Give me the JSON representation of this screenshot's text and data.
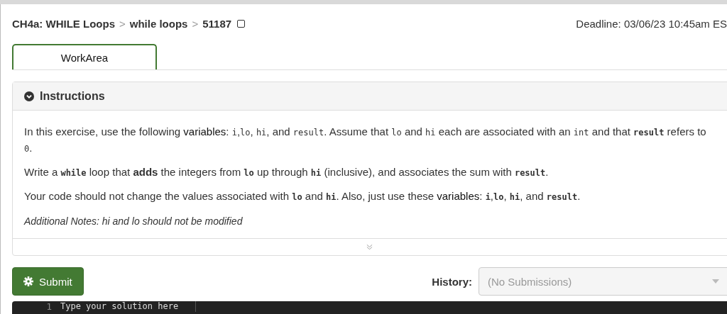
{
  "breadcrumb": [
    {
      "label": "CH4a: WHILE Loops"
    },
    {
      "label": "while loops"
    },
    {
      "label": "51187"
    }
  ],
  "breadcrumb_separator": ">",
  "bookmark": {
    "checked": false
  },
  "deadline": "Deadline: 03/06/23 10:45am ES",
  "tabs": [
    {
      "label": "WorkArea",
      "selected": true
    }
  ],
  "instructions": {
    "title": "Instructions",
    "expanded": true,
    "paragraphs": [
      {
        "kind": "normal",
        "segments": [
          {
            "kind": "text",
            "text": "In this exercise, use the following "
          },
          {
            "kind": "term",
            "text": "variables"
          },
          {
            "kind": "text",
            "text": ": "
          },
          {
            "kind": "code",
            "text": "i"
          },
          {
            "kind": "text",
            "text": ","
          },
          {
            "kind": "code",
            "text": "lo"
          },
          {
            "kind": "text",
            "text": ", "
          },
          {
            "kind": "code",
            "text": "hi"
          },
          {
            "kind": "text",
            "text": ", and "
          },
          {
            "kind": "code",
            "text": "result"
          },
          {
            "kind": "text",
            "text": ". Assume that "
          },
          {
            "kind": "code",
            "text": "lo"
          },
          {
            "kind": "text",
            "text": " and "
          },
          {
            "kind": "code",
            "text": "hi"
          },
          {
            "kind": "text",
            "text": " each are associated with an "
          },
          {
            "kind": "code",
            "text": "int"
          },
          {
            "kind": "text",
            "text": " and that "
          },
          {
            "kind": "code-bold",
            "text": "result"
          },
          {
            "kind": "text",
            "text": " refers to "
          },
          {
            "kind": "code",
            "text": "0"
          },
          {
            "kind": "text",
            "text": "."
          }
        ]
      },
      {
        "kind": "normal",
        "segments": [
          {
            "kind": "text",
            "text": "Write a "
          },
          {
            "kind": "code-bold",
            "text": "while"
          },
          {
            "kind": "text",
            "text": " loop that "
          },
          {
            "kind": "bold",
            "text": "adds"
          },
          {
            "kind": "text",
            "text": " the integers from "
          },
          {
            "kind": "code-bold",
            "text": "lo"
          },
          {
            "kind": "text",
            "text": " up through "
          },
          {
            "kind": "code-bold",
            "text": "hi"
          },
          {
            "kind": "text",
            "text": " (inclusive), and associates the sum with "
          },
          {
            "kind": "code-bold",
            "text": "result"
          },
          {
            "kind": "text",
            "text": "."
          }
        ]
      },
      {
        "kind": "normal",
        "segments": [
          {
            "kind": "text",
            "text": "Your code should not change the values associated with "
          },
          {
            "kind": "code-bold",
            "text": "lo"
          },
          {
            "kind": "text",
            "text": " and "
          },
          {
            "kind": "code-bold",
            "text": "hi"
          },
          {
            "kind": "text",
            "text": ". Also, just use these "
          },
          {
            "kind": "term",
            "text": "variables"
          },
          {
            "kind": "text",
            "text": ": "
          },
          {
            "kind": "code-bold",
            "text": "i"
          },
          {
            "kind": "text",
            "text": ","
          },
          {
            "kind": "code-bold",
            "text": "lo"
          },
          {
            "kind": "text",
            "text": ", "
          },
          {
            "kind": "code-bold",
            "text": "hi"
          },
          {
            "kind": "text",
            "text": ", and "
          },
          {
            "kind": "code-bold",
            "text": "result"
          },
          {
            "kind": "text",
            "text": "."
          }
        ]
      },
      {
        "kind": "note",
        "segments": [
          {
            "kind": "text",
            "text": "Additional Notes: hi and lo should not be modified"
          }
        ]
      }
    ]
  },
  "submit_button": "Submit",
  "history": {
    "label": "History:",
    "placeholder": "(No Submissions)",
    "disabled": true
  },
  "editor": {
    "line_number": "1",
    "placeholder": "Type your solution here"
  }
}
